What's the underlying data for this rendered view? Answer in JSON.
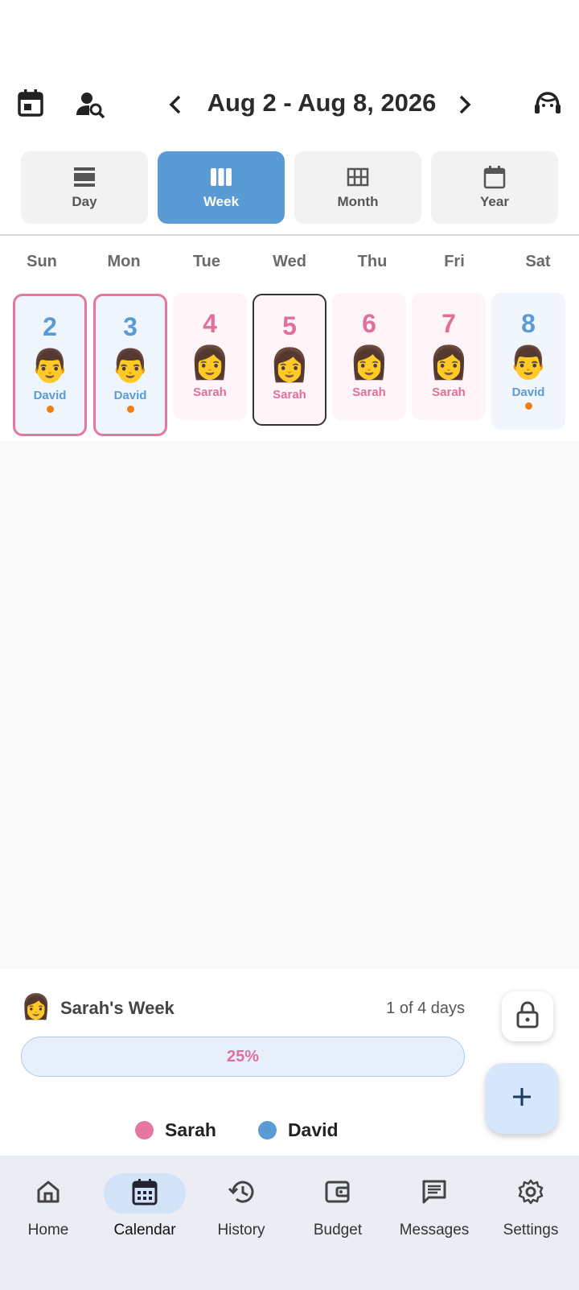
{
  "header": {
    "title": "Aug 2 - Aug 8, 2026",
    "icons": [
      "calendar-today-icon",
      "person-search-icon",
      "chevron-left-icon",
      "chevron-right-icon",
      "support-agent-icon"
    ]
  },
  "view_tabs": [
    {
      "label": "Day",
      "icon": "view-day-icon",
      "active": false
    },
    {
      "label": "Week",
      "icon": "view-week-icon",
      "active": true
    },
    {
      "label": "Month",
      "icon": "view-month-icon",
      "active": false
    },
    {
      "label": "Year",
      "icon": "calendar-icon",
      "active": false
    }
  ],
  "weekdays": [
    "Sun",
    "Mon",
    "Tue",
    "Wed",
    "Thu",
    "Fri",
    "Sat"
  ],
  "days": [
    {
      "date": "2",
      "parent": "David",
      "face": "👨",
      "has_event": true
    },
    {
      "date": "3",
      "parent": "David",
      "face": "👨",
      "has_event": true
    },
    {
      "date": "4",
      "parent": "Sarah",
      "face": "👩",
      "has_event": false
    },
    {
      "date": "5",
      "parent": "Sarah",
      "face": "👩",
      "has_event": false,
      "today": true
    },
    {
      "date": "6",
      "parent": "Sarah",
      "face": "👩",
      "has_event": false
    },
    {
      "date": "7",
      "parent": "Sarah",
      "face": "👩",
      "has_event": false
    },
    {
      "date": "8",
      "parent": "David",
      "face": "👨",
      "has_event": true
    }
  ],
  "summary": {
    "face": "👩",
    "title": "Sarah's Week",
    "count": "1 of 4 days",
    "progress_label": "25%",
    "progress": 0.25
  },
  "legend": [
    {
      "label": "Sarah",
      "color": "#e577a1"
    },
    {
      "label": "David",
      "color": "#5b9bd5"
    }
  ],
  "colors": {
    "sarah": "#e06f9c",
    "david": "#5b9bd5",
    "accent": "#5b9bd5",
    "event_dot": "#f07f12"
  },
  "bottom_nav": [
    {
      "label": "Home",
      "icon": "home-icon",
      "active": false
    },
    {
      "label": "Calendar",
      "icon": "calendar-month-icon",
      "active": true
    },
    {
      "label": "History",
      "icon": "history-icon",
      "active": false
    },
    {
      "label": "Budget",
      "icon": "wallet-icon",
      "active": false
    },
    {
      "label": "Messages",
      "icon": "message-icon",
      "active": false
    },
    {
      "label": "Settings",
      "icon": "settings-icon",
      "active": false
    }
  ]
}
